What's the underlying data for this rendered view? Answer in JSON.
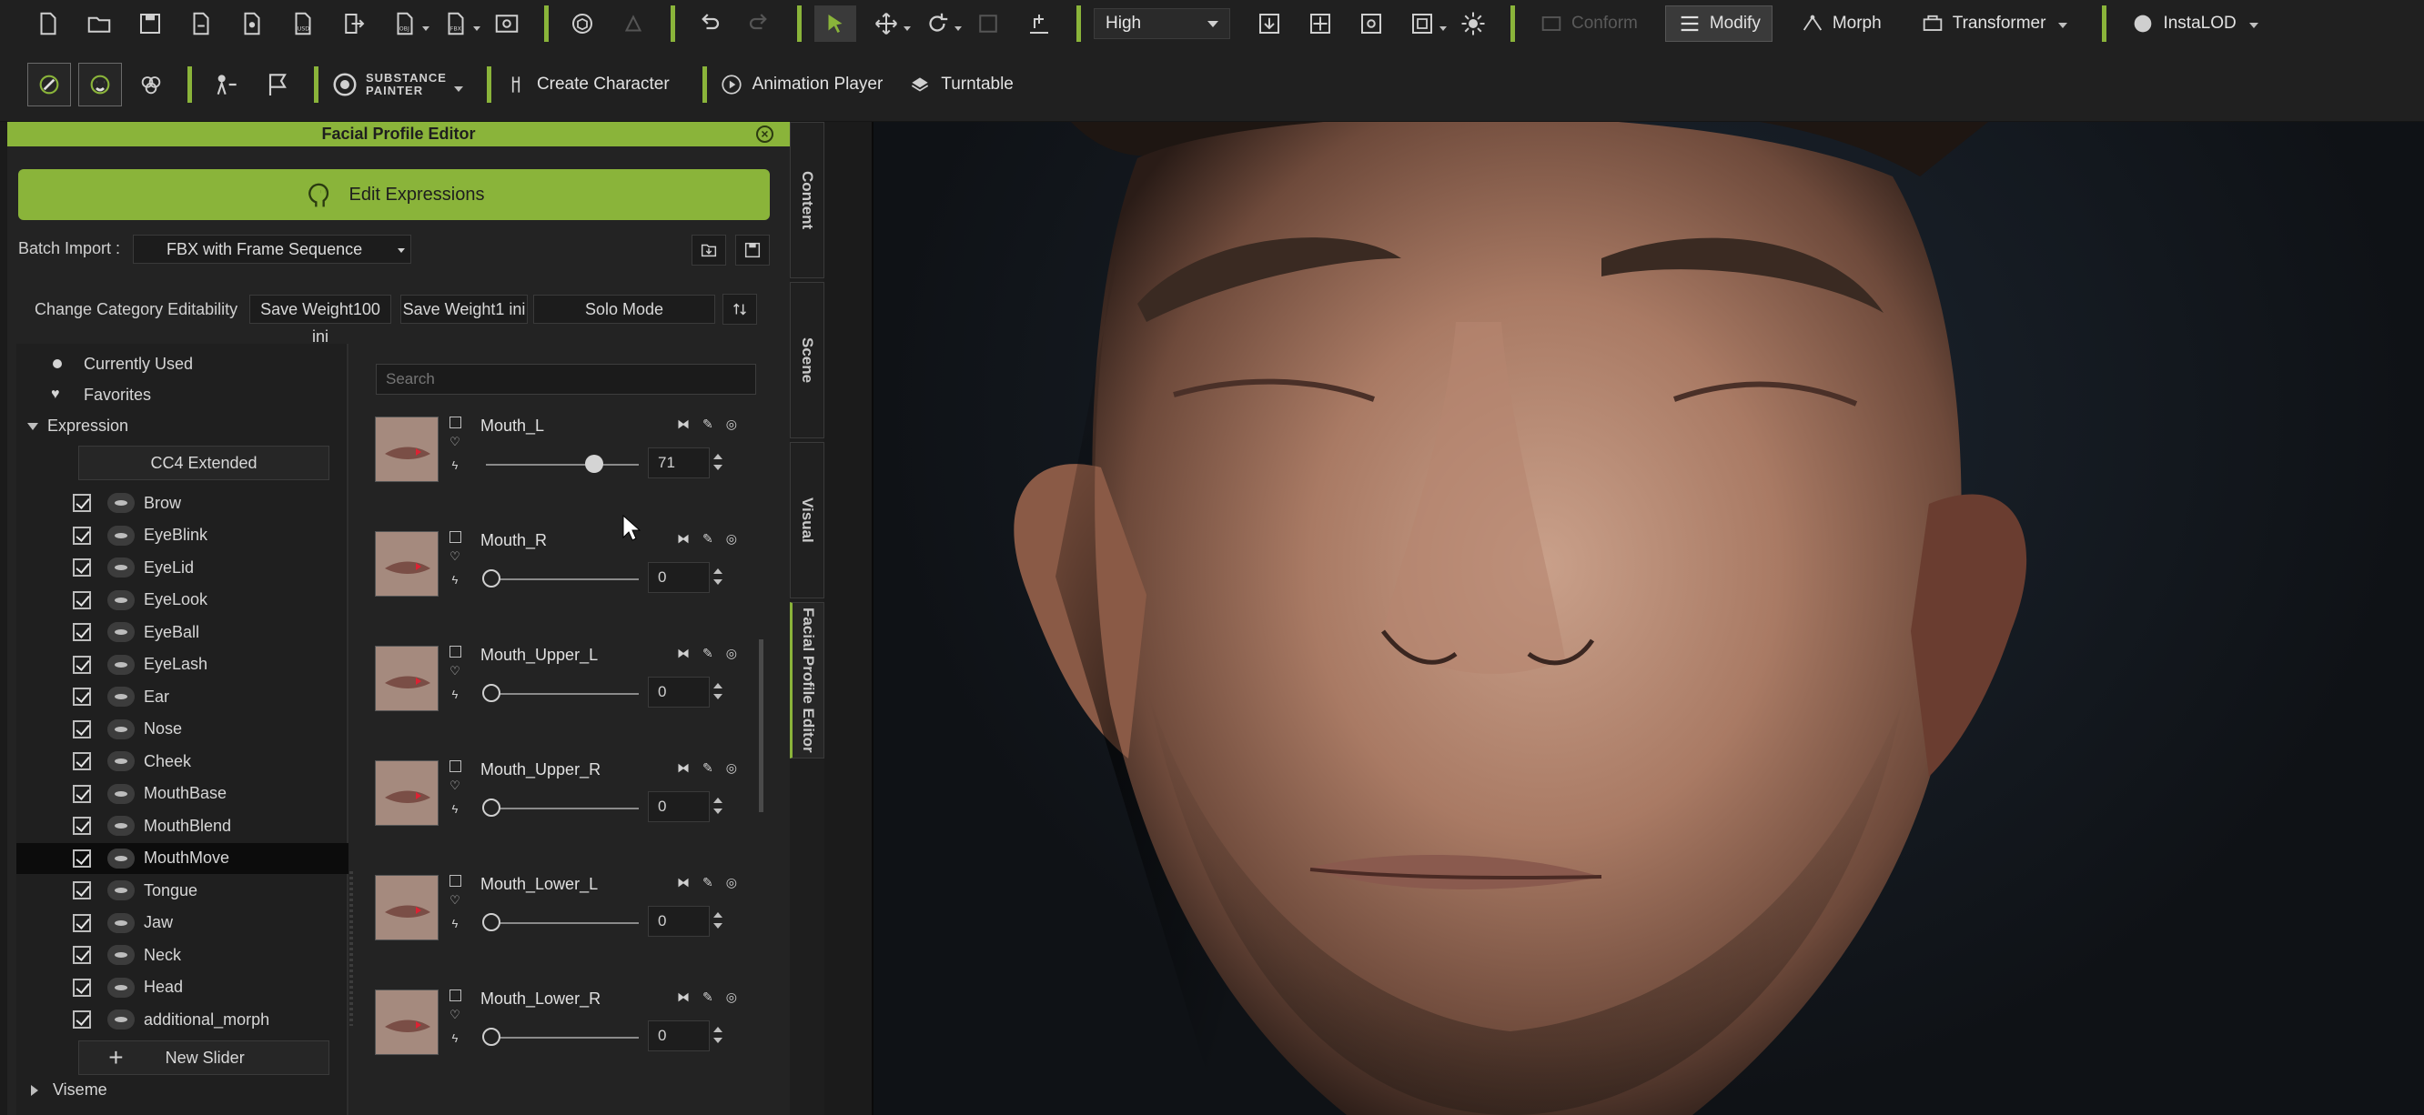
{
  "toolbar": {
    "quality": "High",
    "modify": "Modify",
    "morph": "Morph",
    "transformer": "Transformer",
    "instalod": "InstaLOD",
    "conform": "Conform"
  },
  "toolbar2": {
    "substance_top": "SUBSTANCE",
    "substance_bottom": "PAINTER",
    "create_character": "Create Character",
    "animation_player": "Animation Player",
    "turntable": "Turntable"
  },
  "panel": {
    "title": "Facial Profile Editor",
    "edit_expressions": "Edit Expressions",
    "batch_import_label": "Batch Import :",
    "batch_import_value": "FBX with Frame Sequence",
    "category_label": "Change Category Editability",
    "save100": "Save Weight100 ini",
    "save1": "Save Weight1 ini",
    "solo": "Solo Mode"
  },
  "tree": {
    "currently_used": "Currently Used",
    "favorites": "Favorites",
    "expression": "Expression",
    "cc4_extended": "CC4 Extended",
    "categories": [
      "Brow",
      "EyeBlink",
      "EyeLid",
      "EyeLook",
      "EyeBall",
      "EyeLash",
      "Ear",
      "Nose",
      "Cheek",
      "MouthBase",
      "MouthBlend",
      "MouthMove",
      "Tongue",
      "Jaw",
      "Neck",
      "Head",
      "additional_morph"
    ],
    "selected": "MouthMove",
    "new_slider": "New Slider",
    "viseme": "Viseme"
  },
  "list": {
    "search_placeholder": "Search",
    "morphs": [
      {
        "name": "Mouth_L",
        "value": "71",
        "fraction": 0.71
      },
      {
        "name": "Mouth_R",
        "value": "0",
        "fraction": 0
      },
      {
        "name": "Mouth_Upper_L",
        "value": "0",
        "fraction": 0
      },
      {
        "name": "Mouth_Upper_R",
        "value": "0",
        "fraction": 0
      },
      {
        "name": "Mouth_Lower_L",
        "value": "0",
        "fraction": 0
      },
      {
        "name": "Mouth_Lower_R",
        "value": "0",
        "fraction": 0
      }
    ]
  },
  "tabs": {
    "content": "Content",
    "scene": "Scene",
    "visual": "Visual",
    "facial_profile": "Facial Profile Editor"
  },
  "colors": {
    "accent": "#8ab43a",
    "panel_bg": "#232323"
  }
}
